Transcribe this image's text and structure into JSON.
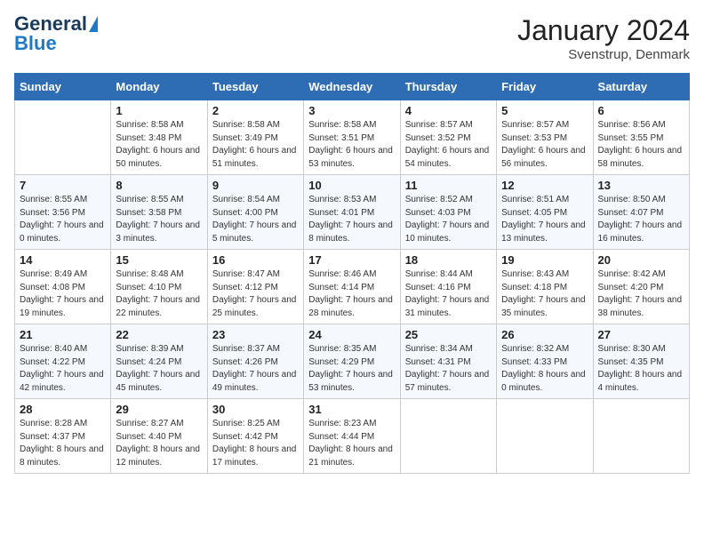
{
  "header": {
    "logo_general": "General",
    "logo_blue": "Blue",
    "title": "January 2024",
    "location": "Svenstrup, Denmark"
  },
  "weekdays": [
    "Sunday",
    "Monday",
    "Tuesday",
    "Wednesday",
    "Thursday",
    "Friday",
    "Saturday"
  ],
  "weeks": [
    [
      {
        "day": "",
        "sunrise": "",
        "sunset": "",
        "daylight": ""
      },
      {
        "day": "1",
        "sunrise": "Sunrise: 8:58 AM",
        "sunset": "Sunset: 3:48 PM",
        "daylight": "Daylight: 6 hours and 50 minutes."
      },
      {
        "day": "2",
        "sunrise": "Sunrise: 8:58 AM",
        "sunset": "Sunset: 3:49 PM",
        "daylight": "Daylight: 6 hours and 51 minutes."
      },
      {
        "day": "3",
        "sunrise": "Sunrise: 8:58 AM",
        "sunset": "Sunset: 3:51 PM",
        "daylight": "Daylight: 6 hours and 53 minutes."
      },
      {
        "day": "4",
        "sunrise": "Sunrise: 8:57 AM",
        "sunset": "Sunset: 3:52 PM",
        "daylight": "Daylight: 6 hours and 54 minutes."
      },
      {
        "day": "5",
        "sunrise": "Sunrise: 8:57 AM",
        "sunset": "Sunset: 3:53 PM",
        "daylight": "Daylight: 6 hours and 56 minutes."
      },
      {
        "day": "6",
        "sunrise": "Sunrise: 8:56 AM",
        "sunset": "Sunset: 3:55 PM",
        "daylight": "Daylight: 6 hours and 58 minutes."
      }
    ],
    [
      {
        "day": "7",
        "sunrise": "Sunrise: 8:55 AM",
        "sunset": "Sunset: 3:56 PM",
        "daylight": "Daylight: 7 hours and 0 minutes."
      },
      {
        "day": "8",
        "sunrise": "Sunrise: 8:55 AM",
        "sunset": "Sunset: 3:58 PM",
        "daylight": "Daylight: 7 hours and 3 minutes."
      },
      {
        "day": "9",
        "sunrise": "Sunrise: 8:54 AM",
        "sunset": "Sunset: 4:00 PM",
        "daylight": "Daylight: 7 hours and 5 minutes."
      },
      {
        "day": "10",
        "sunrise": "Sunrise: 8:53 AM",
        "sunset": "Sunset: 4:01 PM",
        "daylight": "Daylight: 7 hours and 8 minutes."
      },
      {
        "day": "11",
        "sunrise": "Sunrise: 8:52 AM",
        "sunset": "Sunset: 4:03 PM",
        "daylight": "Daylight: 7 hours and 10 minutes."
      },
      {
        "day": "12",
        "sunrise": "Sunrise: 8:51 AM",
        "sunset": "Sunset: 4:05 PM",
        "daylight": "Daylight: 7 hours and 13 minutes."
      },
      {
        "day": "13",
        "sunrise": "Sunrise: 8:50 AM",
        "sunset": "Sunset: 4:07 PM",
        "daylight": "Daylight: 7 hours and 16 minutes."
      }
    ],
    [
      {
        "day": "14",
        "sunrise": "Sunrise: 8:49 AM",
        "sunset": "Sunset: 4:08 PM",
        "daylight": "Daylight: 7 hours and 19 minutes."
      },
      {
        "day": "15",
        "sunrise": "Sunrise: 8:48 AM",
        "sunset": "Sunset: 4:10 PM",
        "daylight": "Daylight: 7 hours and 22 minutes."
      },
      {
        "day": "16",
        "sunrise": "Sunrise: 8:47 AM",
        "sunset": "Sunset: 4:12 PM",
        "daylight": "Daylight: 7 hours and 25 minutes."
      },
      {
        "day": "17",
        "sunrise": "Sunrise: 8:46 AM",
        "sunset": "Sunset: 4:14 PM",
        "daylight": "Daylight: 7 hours and 28 minutes."
      },
      {
        "day": "18",
        "sunrise": "Sunrise: 8:44 AM",
        "sunset": "Sunset: 4:16 PM",
        "daylight": "Daylight: 7 hours and 31 minutes."
      },
      {
        "day": "19",
        "sunrise": "Sunrise: 8:43 AM",
        "sunset": "Sunset: 4:18 PM",
        "daylight": "Daylight: 7 hours and 35 minutes."
      },
      {
        "day": "20",
        "sunrise": "Sunrise: 8:42 AM",
        "sunset": "Sunset: 4:20 PM",
        "daylight": "Daylight: 7 hours and 38 minutes."
      }
    ],
    [
      {
        "day": "21",
        "sunrise": "Sunrise: 8:40 AM",
        "sunset": "Sunset: 4:22 PM",
        "daylight": "Daylight: 7 hours and 42 minutes."
      },
      {
        "day": "22",
        "sunrise": "Sunrise: 8:39 AM",
        "sunset": "Sunset: 4:24 PM",
        "daylight": "Daylight: 7 hours and 45 minutes."
      },
      {
        "day": "23",
        "sunrise": "Sunrise: 8:37 AM",
        "sunset": "Sunset: 4:26 PM",
        "daylight": "Daylight: 7 hours and 49 minutes."
      },
      {
        "day": "24",
        "sunrise": "Sunrise: 8:35 AM",
        "sunset": "Sunset: 4:29 PM",
        "daylight": "Daylight: 7 hours and 53 minutes."
      },
      {
        "day": "25",
        "sunrise": "Sunrise: 8:34 AM",
        "sunset": "Sunset: 4:31 PM",
        "daylight": "Daylight: 7 hours and 57 minutes."
      },
      {
        "day": "26",
        "sunrise": "Sunrise: 8:32 AM",
        "sunset": "Sunset: 4:33 PM",
        "daylight": "Daylight: 8 hours and 0 minutes."
      },
      {
        "day": "27",
        "sunrise": "Sunrise: 8:30 AM",
        "sunset": "Sunset: 4:35 PM",
        "daylight": "Daylight: 8 hours and 4 minutes."
      }
    ],
    [
      {
        "day": "28",
        "sunrise": "Sunrise: 8:28 AM",
        "sunset": "Sunset: 4:37 PM",
        "daylight": "Daylight: 8 hours and 8 minutes."
      },
      {
        "day": "29",
        "sunrise": "Sunrise: 8:27 AM",
        "sunset": "Sunset: 4:40 PM",
        "daylight": "Daylight: 8 hours and 12 minutes."
      },
      {
        "day": "30",
        "sunrise": "Sunrise: 8:25 AM",
        "sunset": "Sunset: 4:42 PM",
        "daylight": "Daylight: 8 hours and 17 minutes."
      },
      {
        "day": "31",
        "sunrise": "Sunrise: 8:23 AM",
        "sunset": "Sunset: 4:44 PM",
        "daylight": "Daylight: 8 hours and 21 minutes."
      },
      {
        "day": "",
        "sunrise": "",
        "sunset": "",
        "daylight": ""
      },
      {
        "day": "",
        "sunrise": "",
        "sunset": "",
        "daylight": ""
      },
      {
        "day": "",
        "sunrise": "",
        "sunset": "",
        "daylight": ""
      }
    ]
  ]
}
